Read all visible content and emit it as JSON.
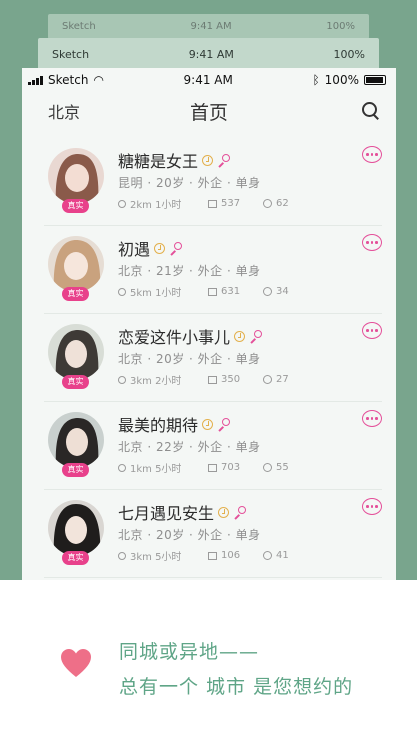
{
  "status_back": {
    "carrier": "Sketch",
    "time": "9:41 AM",
    "battery": "100%"
  },
  "status_mid": {
    "carrier": "Sketch",
    "time": "9:41 AM",
    "battery": "100%"
  },
  "status": {
    "carrier": "Sketch",
    "time": "9:41 AM",
    "battery": "100%"
  },
  "nav": {
    "city": "北京",
    "title": "首页"
  },
  "users": [
    {
      "name": "糖糖是女王",
      "badge": "真实",
      "info": "昆明 · 20岁 · 外企 · 单身",
      "distance_time": "2km 1小时",
      "photos": "537",
      "views": "62"
    },
    {
      "name": "初遇",
      "badge": "真实",
      "info": "北京 · 21岁 · 外企 · 单身",
      "distance_time": "5km 1小时",
      "photos": "631",
      "views": "34"
    },
    {
      "name": "恋爱这件小事儿",
      "badge": "真实",
      "info": "北京 · 20岁 · 外企 · 单身",
      "distance_time": "3km 2小时",
      "photos": "350",
      "views": "27"
    },
    {
      "name": "最美的期待",
      "badge": "真实",
      "info": "北京 · 22岁 · 外企 · 单身",
      "distance_time": "1km 5小时",
      "photos": "703",
      "views": "55"
    },
    {
      "name": "七月遇见安生",
      "badge": "真实",
      "info": "北京 · 20岁 · 外企 · 单身",
      "distance_time": "3km 5小时",
      "photos": "106",
      "views": "41"
    }
  ],
  "slogan": {
    "line1": "同城或异地——",
    "line2": "总有一个 城市 是您想约的"
  },
  "colors": {
    "accent_pink": "#e4509a",
    "brand_green": "#79a58d",
    "slogan_green": "#5fa587",
    "gold": "#e3b04c"
  }
}
